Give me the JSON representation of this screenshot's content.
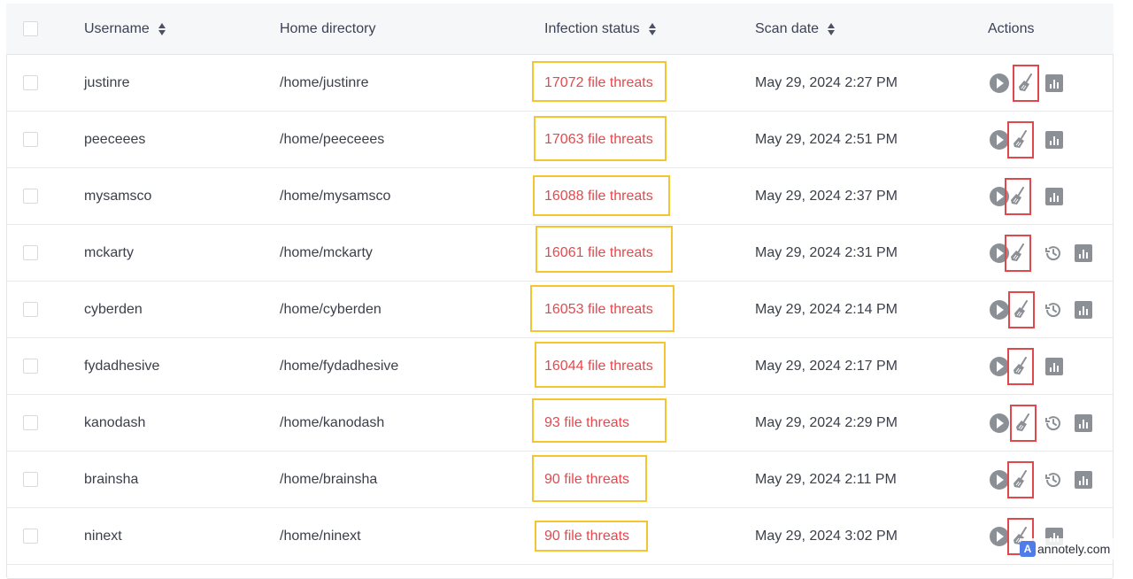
{
  "columns": {
    "username": "Username",
    "home_directory": "Home directory",
    "infection_status": "Infection status",
    "scan_date": "Scan date",
    "actions": "Actions"
  },
  "rows": [
    {
      "username": "justinre",
      "home": "/home/justinre",
      "status": "17072 file threats",
      "date": "May 29, 2024 2:27 PM",
      "has_history": false
    },
    {
      "username": "peeceees",
      "home": "/home/peeceees",
      "status": "17063 file threats",
      "date": "May 29, 2024 2:51 PM",
      "has_history": false
    },
    {
      "username": "mysamsco",
      "home": "/home/mysamsco",
      "status": "16088 file threats",
      "date": "May 29, 2024 2:37 PM",
      "has_history": false
    },
    {
      "username": "mckarty",
      "home": "/home/mckarty",
      "status": "16061 file threats",
      "date": "May 29, 2024 2:31 PM",
      "has_history": true
    },
    {
      "username": "cyberden",
      "home": "/home/cyberden",
      "status": "16053 file threats",
      "date": "May 29, 2024 2:14 PM",
      "has_history": true
    },
    {
      "username": "fydadhesive",
      "home": "/home/fydadhesive",
      "status": "16044 file threats",
      "date": "May 29, 2024 2:17 PM",
      "has_history": false
    },
    {
      "username": "kanodash",
      "home": "/home/kanodash",
      "status": "93 file threats",
      "date": "May 29, 2024 2:29 PM",
      "has_history": true
    },
    {
      "username": "brainsha",
      "home": "/home/brainsha",
      "status": "90 file threats",
      "date": "May 29, 2024 2:11 PM",
      "has_history": true
    },
    {
      "username": "ninext",
      "home": "/home/ninext",
      "status": "90 file threats",
      "date": "May 29, 2024 3:02 PM",
      "has_history": false
    }
  ],
  "colors": {
    "threat_text": "#e5484d",
    "threat_highlight": "#f5c531",
    "action_highlight": "#e0484c",
    "icon_gray": "#8b8f96"
  },
  "icons": [
    "sort-icon",
    "play-icon",
    "broom-icon",
    "history-icon",
    "stats-icon"
  ],
  "watermark": {
    "logo": "A",
    "text": "annotely.com"
  }
}
